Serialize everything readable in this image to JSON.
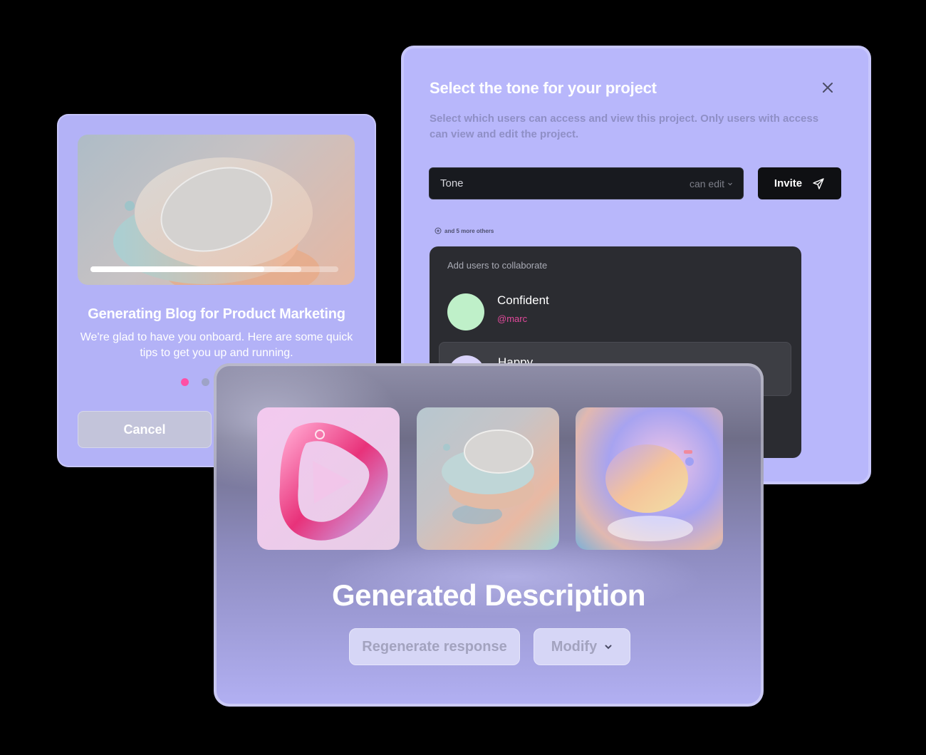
{
  "blog_card": {
    "title": "Generating Blog for Product Marketing",
    "description": "We're glad to have you onboard. Here are some quick tips to get you up and running.",
    "progress": 0.7,
    "buffered": 0.85,
    "pagination": {
      "total": 2,
      "active": 0,
      "active_color": "#ff4fa6",
      "inactive_color": "#9ea3c7"
    },
    "cancel_label": "Cancel"
  },
  "tone_modal": {
    "title": "Select the tone for your project",
    "description": "Select which users can access and view this project. Only users with access can view and edit the project.",
    "tone_field": {
      "value": "Tone",
      "permission": "can edit"
    },
    "invite_label": "Invite",
    "others_label": "and 5 more others",
    "collab_header": "Add users to collaborate",
    "users": [
      {
        "name": "Confident",
        "handle": "@marc",
        "avatar_color": "#bff0c9"
      },
      {
        "name": "Happy",
        "handle": "",
        "avatar_color": "#d9d3fb"
      }
    ]
  },
  "description_card": {
    "headline": "Generated Description",
    "regenerate_label": "Regenerate response",
    "modify_label": "Modify",
    "thumbnails": [
      "play-ring-image",
      "stacked-discs-image",
      "pastel-sphere-image"
    ]
  }
}
